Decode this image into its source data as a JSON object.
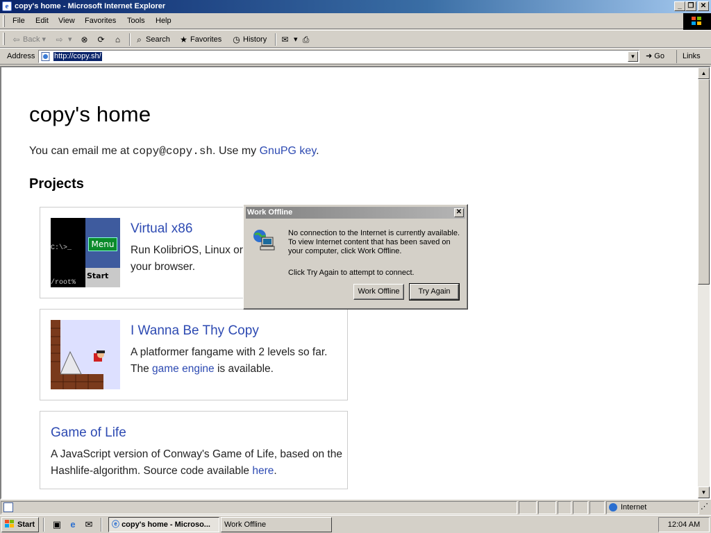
{
  "window": {
    "title": "copy's home - Microsoft Internet Explorer",
    "controls": {
      "minimize": "_",
      "maximize": "❐",
      "close": "✕"
    }
  },
  "menu": [
    "File",
    "Edit",
    "View",
    "Favorites",
    "Tools",
    "Help"
  ],
  "toolbar": {
    "back": "Back",
    "search": "Search",
    "favorites": "Favorites",
    "history": "History"
  },
  "address": {
    "label": "Address",
    "url": "http://copy.sh/",
    "go": "Go",
    "links": "Links"
  },
  "page": {
    "title": "copy's home",
    "intro_prefix": "You can email me at ",
    "email": "copy@copy.sh",
    "intro_mid": ". Use my ",
    "gpg_link": "GnuPG key",
    "intro_end": ".",
    "projects_heading": "Projects",
    "projects": [
      {
        "title": "Virtual x86",
        "desc": "Run KolibriOS, Linux or Windows 98 in your browser.",
        "thumb": {
          "prompt": "C:\\>_",
          "menu": "Menu",
          "root": "/root%",
          "start": "Start"
        }
      },
      {
        "title": "I Wanna Be Thy Copy",
        "desc_prefix": "A platformer fangame with 2 levels so far. The ",
        "desc_link": "game engine",
        "desc_suffix": " is available."
      },
      {
        "title": "Game of Life",
        "desc_prefix": "A JavaScript version of Conway's Game of Life, based on the Hashlife-algorithm. Source code available ",
        "desc_link": "here",
        "desc_suffix": "."
      }
    ]
  },
  "dialog": {
    "title": "Work Offline",
    "close": "✕",
    "message": "No connection to the Internet is currently available. To view Internet content that has been saved on your computer, click Work Offline.",
    "message2": "Click Try Again to attempt to connect.",
    "work_offline": "Work Offline",
    "try_again": "Try Again"
  },
  "status": {
    "zone": "Internet"
  },
  "taskbar": {
    "start": "Start",
    "tasks": [
      "copy's home - Microso...",
      "Work Offline"
    ],
    "clock": "12:04 AM"
  },
  "colors": {
    "link": "#2d4ab2",
    "titlebar": "#0a246a",
    "face": "#d4d0c8"
  }
}
